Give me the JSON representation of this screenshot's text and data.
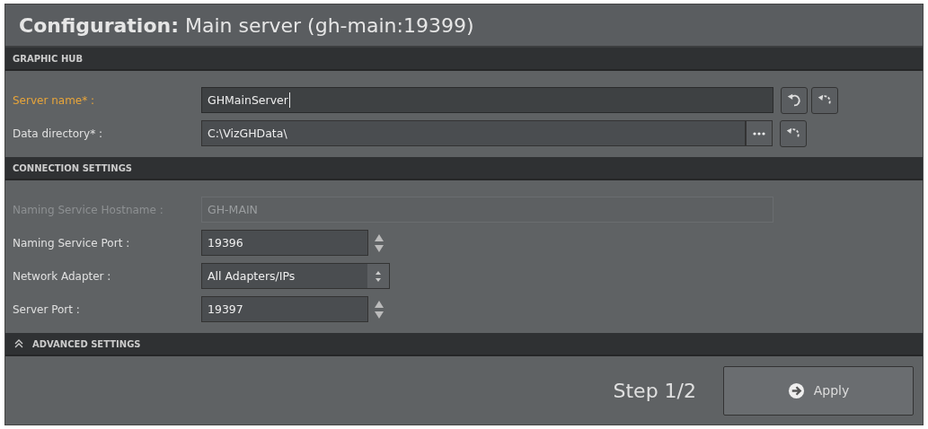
{
  "window": {
    "title": "**Configuration:** Main server (gh-main:19399)"
  },
  "sections": [
    {
      "title": "GRAPHIC HUB",
      "collapsible": false,
      "fields": [
        {
          "kind": "text",
          "label": "Server name* :",
          "value": "GHMainServer",
          "highlighted": true,
          "disabled": false,
          "focused": true,
          "actions": [
            {
              "kind": "undo"
            },
            {
              "kind": "reset"
            }
          ]
        },
        {
          "kind": "path",
          "label": "Data directory* :",
          "value": "C:\\VizGHData\\",
          "highlighted": false,
          "disabled": false,
          "focused": false,
          "actions": [
            {
              "kind": "reset"
            }
          ]
        }
      ]
    },
    {
      "title": "CONNECTION SETTINGS",
      "collapsible": false,
      "fields": [
        {
          "kind": "text",
          "label": "Naming Service Hostname :",
          "value": "GH-MAIN",
          "highlighted": false,
          "disabled": true,
          "focused": false
        },
        {
          "kind": "spinner",
          "label": "Naming Service Port :",
          "value": "19396",
          "highlighted": false,
          "disabled": false,
          "focused": false
        },
        {
          "kind": "dropdown",
          "label": "Network Adapter :",
          "value": "All Adapters/IPs",
          "highlighted": false,
          "disabled": false,
          "focused": false
        },
        {
          "kind": "spinner",
          "label": "Server Port :",
          "value": "19397",
          "highlighted": false,
          "disabled": false,
          "focused": false
        }
      ]
    },
    {
      "title": "ADVANCED SETTINGS",
      "collapsible": true
    }
  ],
  "footer": {
    "step": "Step 1/2",
    "button": "Apply"
  }
}
